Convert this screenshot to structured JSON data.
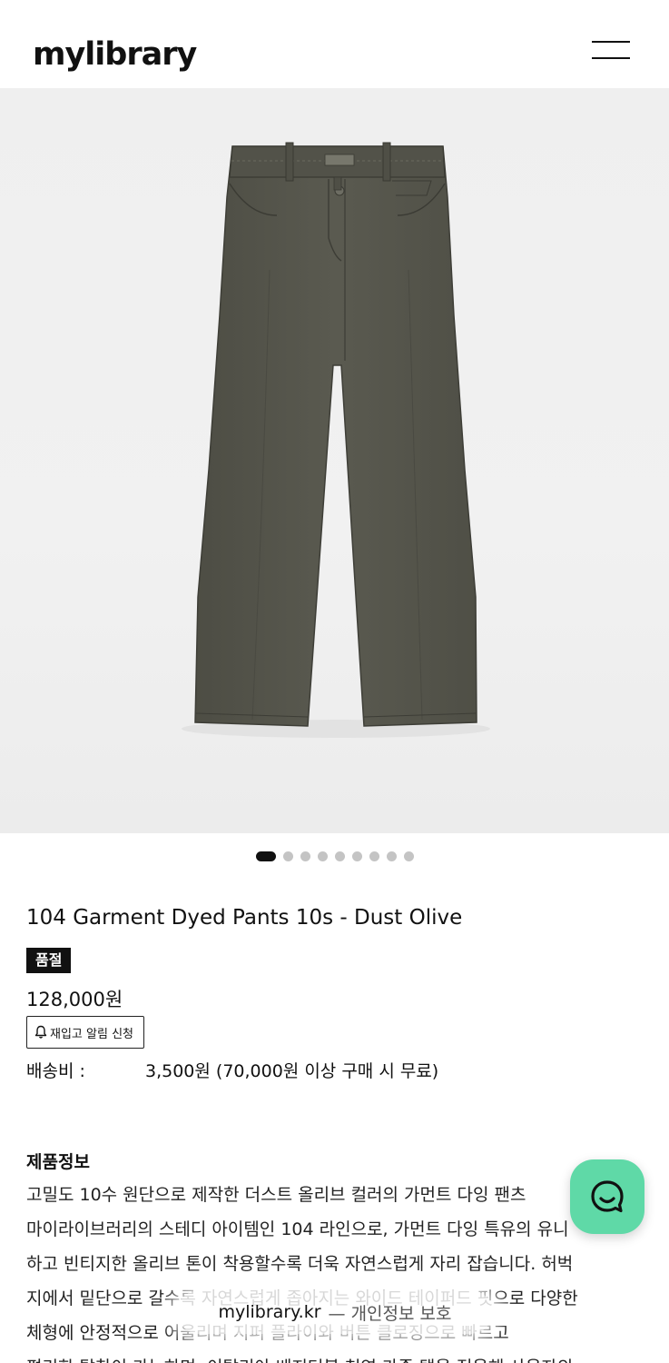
{
  "header": {
    "logo": "mylibrary",
    "menu_icon": "hamburger-menu-icon"
  },
  "gallery": {
    "image_alt": "olive garment dyed pants",
    "dot_count": 9,
    "active_index": 0
  },
  "product": {
    "title": "104 Garment Dyed Pants 10s - Dust Olive",
    "soldout_badge": "품절",
    "price": "128,000원",
    "restock_button": "재입고 알림 신청",
    "shipping_label": "배송비 :",
    "shipping_value": "3,500원 (70,000원 이상 구매 시 무료)"
  },
  "info": {
    "heading": "제품정보",
    "lines": [
      "고밀도 10수 원단으로 제작한 더스트 올리브 컬러의 가먼트 다잉 팬츠",
      "마이라이브러리의 스테디 아이템인 104 라인으로, 가먼트 다잉 특유의 유니",
      "하고 빈티지한 올리브 톤이 착용할수록 더욱 자연스럽게 자리 잡습니다. 허벅",
      "지에서 밑단으로 갈수록 자연스럽게 좁아지는 와이드 테이퍼드 핏으로 다양한",
      "체형에 안정적으로 어울리며 지퍼 플라이와 버튼 클로징으로 빠르고",
      "편리한 탈착이 가능하며, 이탈리아 베지터블 천연 가죽 탭을 적용해 사용자의"
    ]
  },
  "chat": {
    "icon": "chat-smile-icon"
  },
  "privacy": {
    "domain": "mylibrary.kr",
    "text": "— 개인정보 보호"
  },
  "colors": {
    "accent": "#5fd9a7",
    "badge_bg": "#111111",
    "pants": "#56564c"
  }
}
